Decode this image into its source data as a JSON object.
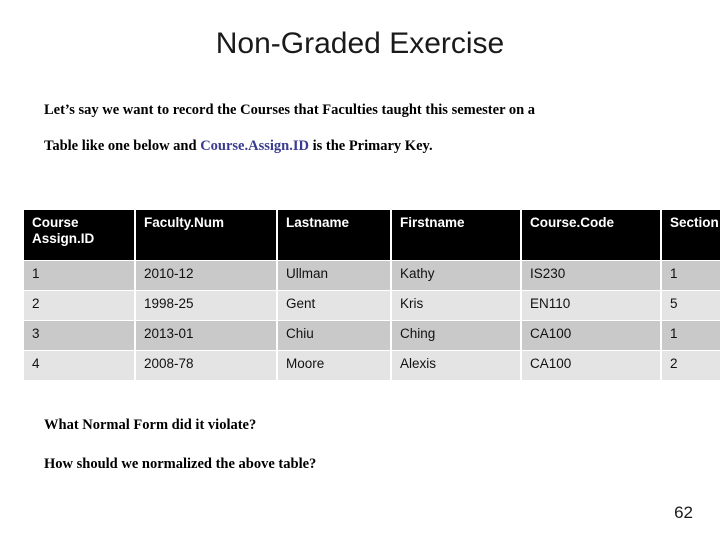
{
  "slide": {
    "title": "Non-Graded Exercise",
    "page_number": "62"
  },
  "intro": {
    "line1": "Let’s say we want to record the Courses that Faculties taught this semester on a",
    "line2_prefix": "Table like one below and ",
    "primary_key_ref": "Course.Assign.ID",
    "line2_suffix": " is the Primary Key.",
    "primary_key_color": "#3b3b8f"
  },
  "table": {
    "header_background": "#000000",
    "header_text_color": "#ffffff",
    "row_odd_background": "#c9c9c9",
    "row_even_background": "#e4e4e4",
    "columns": [
      "Course Assign.ID",
      "Faculty.Num",
      "Lastname",
      "Firstname",
      "Course.Code",
      "Section"
    ],
    "rows": [
      [
        "1",
        "2010-12",
        "Ullman",
        "Kathy",
        "IS230",
        "1"
      ],
      [
        "2",
        "1998-25",
        "Gent",
        "Kris",
        "EN110",
        "5"
      ],
      [
        "3",
        "2013-01",
        "Chiu",
        "Ching",
        "CA100",
        "1"
      ],
      [
        "4",
        "2008-78",
        "Moore",
        "Alexis",
        "CA100",
        "2"
      ]
    ]
  },
  "questions": {
    "q1": "What Normal Form did it violate?",
    "q2": "How should we normalized the above table?"
  }
}
